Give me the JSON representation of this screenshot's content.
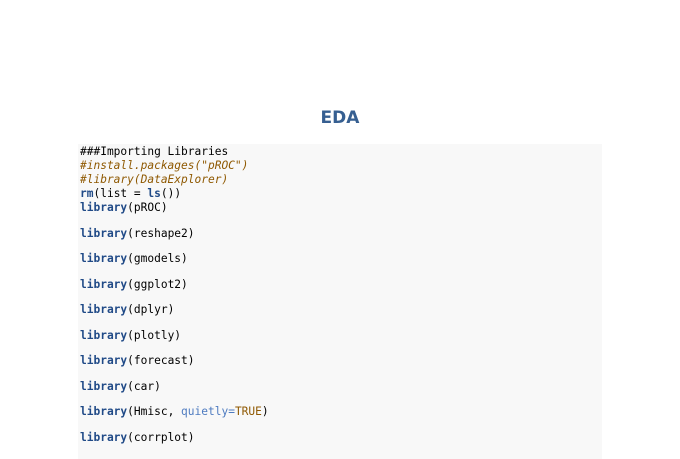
{
  "document": {
    "title": "EDA"
  },
  "code": {
    "header_comment": "###Importing Libraries",
    "comment_install": "#install.packages(\"pROC\")",
    "comment_library": "#library(DataExplorer)",
    "rm_fn": "rm",
    "rm_args": "(list = ",
    "ls_fn": "ls",
    "rm_close": "())",
    "library_keyword": "library",
    "libraries": [
      "(pROC)",
      "(reshape2)",
      "(gmodels)",
      "(ggplot2)",
      "(dplyr)",
      "(plotly)",
      "(forecast)",
      "(car)"
    ],
    "hmisc_open": "(Hmisc, ",
    "hmisc_arg": "quietly=",
    "hmisc_value": "TRUE",
    "hmisc_close": ")",
    "corrplot": "(corrplot)"
  },
  "colors": {
    "title": "#365f91",
    "keyword": "#204a87",
    "comment": "#8f5902",
    "argument": "#4e7bc0",
    "code_background": "#f8f8f8"
  }
}
